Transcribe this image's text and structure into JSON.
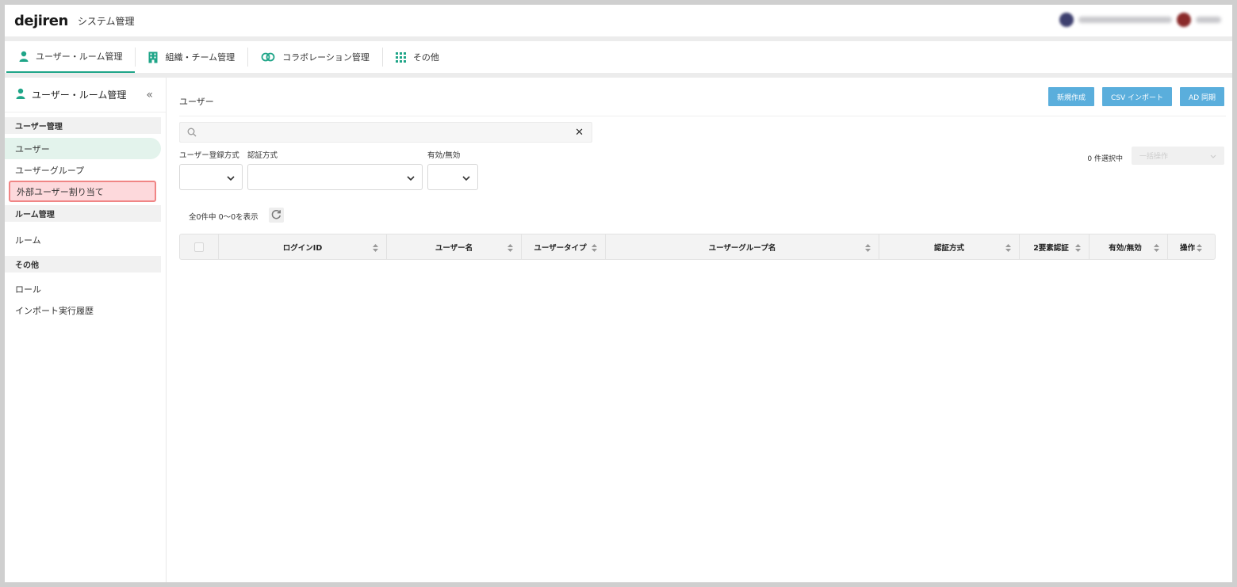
{
  "header": {
    "logo": "dejiren",
    "app_title": "システム管理"
  },
  "tabs": [
    {
      "label": "ユーザー・ルーム管理",
      "icon": "person-icon"
    },
    {
      "label": "組織・チーム管理",
      "icon": "building-icon"
    },
    {
      "label": "コラボレーション管理",
      "icon": "link-icon"
    },
    {
      "label": "その他",
      "icon": "grid-icon"
    }
  ],
  "sidebar": {
    "title": "ユーザー・ルーム管理",
    "collapse": "«",
    "sections": [
      {
        "title": "ユーザー管理",
        "items": [
          "ユーザー",
          "ユーザーグループ",
          "外部ユーザー割り当て"
        ]
      },
      {
        "title": "ルーム管理",
        "items": [
          "ルーム"
        ]
      },
      {
        "title": "その他",
        "items": [
          "ロール",
          "インポート実行履歴"
        ]
      }
    ]
  },
  "main": {
    "title": "ユーザー",
    "buttons": [
      "新規作成",
      "CSV インポート",
      "AD 同期"
    ],
    "filters": {
      "registration_method": "ユーザー登録方式",
      "auth_method": "認証方式",
      "enabled": "有効/無効"
    },
    "selected_count": "0 件選択中",
    "bulk_action": "一括操作",
    "result_count": "全0件中 0〜0を表示",
    "table_headers": [
      "ログインID",
      "ユーザー名",
      "ユーザータイプ",
      "ユーザーグループ名",
      "認証方式",
      "2要素認証",
      "有効/無効",
      "操作"
    ]
  },
  "colors": {
    "accent": "#1fa588",
    "button": "#5aaedc",
    "highlight_border": "#f08585",
    "highlight_fill": "#fdd9dc",
    "active_item": "#e3f3ec"
  }
}
